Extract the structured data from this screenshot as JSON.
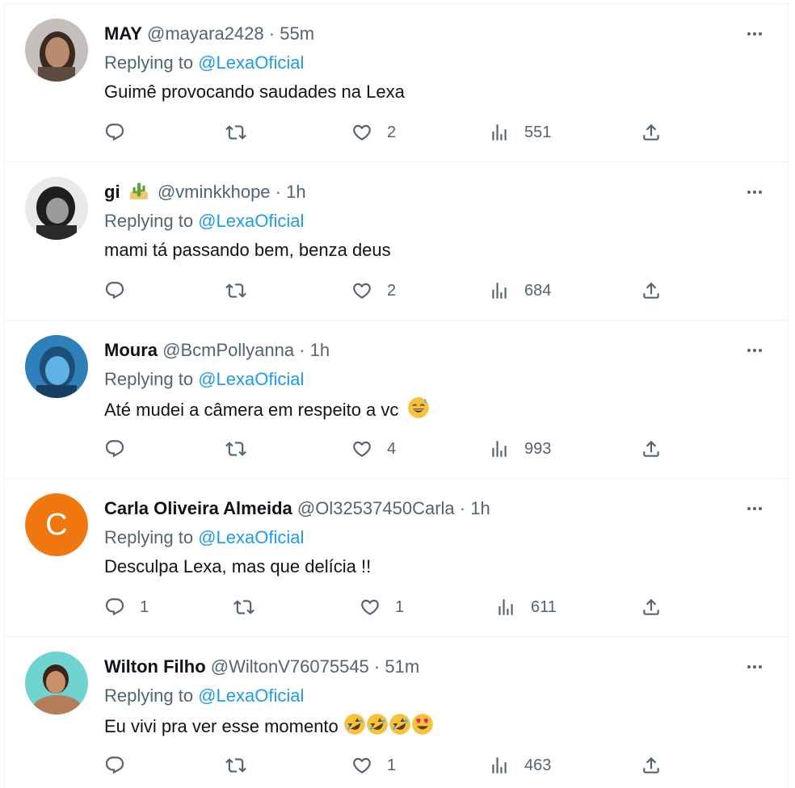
{
  "tweets": [
    {
      "name": "MAY",
      "handle": "@mayara2428",
      "time": "55m",
      "replying_prefix": "Replying to",
      "mention": "@LexaOficial",
      "text": "Guimê provocando saudades na Lexa",
      "replies": "",
      "retweets": "",
      "likes": "2",
      "views": "551"
    },
    {
      "name": "gi",
      "handle": "@vminkkhope",
      "time": "1h",
      "replying_prefix": "Replying to",
      "mention": "@LexaOficial",
      "text": "mami tá passando bem, benza deus",
      "replies": "",
      "retweets": "",
      "likes": "2",
      "views": "684"
    },
    {
      "name": "Moura",
      "handle": "@BcmPollyanna",
      "time": "1h",
      "replying_prefix": "Replying to",
      "mention": "@LexaOficial",
      "text": "Até mudei a câmera em respeito a vc",
      "replies": "",
      "retweets": "",
      "likes": "4",
      "views": "993"
    },
    {
      "name": "Carla Oliveira Almeida",
      "handle": "@Ol32537450Carla",
      "time": "1h",
      "avatar_letter": "C",
      "replying_prefix": "Replying to",
      "mention": "@LexaOficial",
      "text": "Desculpa Lexa, mas que delícia !!",
      "replies": "1",
      "retweets": "",
      "likes": "1",
      "views": "611"
    },
    {
      "name": "Wilton Filho",
      "handle": "@WiltonV76075545",
      "time": "51m",
      "replying_prefix": "Replying to",
      "mention": "@LexaOficial",
      "text": "Eu vivi pra ver esse momento",
      "replies": "",
      "retweets": "",
      "likes": "1",
      "views": "463"
    }
  ],
  "separator": "·",
  "colors": {
    "text": "#0f1419",
    "secondary": "#536471",
    "link": "#1d9bf0",
    "border": "#eff3f4",
    "avatar_c": "#f0760f"
  },
  "icons": [
    "reply-icon",
    "retweet-icon",
    "like-icon",
    "views-icon",
    "share-icon",
    "more-icon",
    "cactus-emoji",
    "sweat-smile-emoji",
    "rofl-emoji",
    "heart-eyes-emoji"
  ]
}
